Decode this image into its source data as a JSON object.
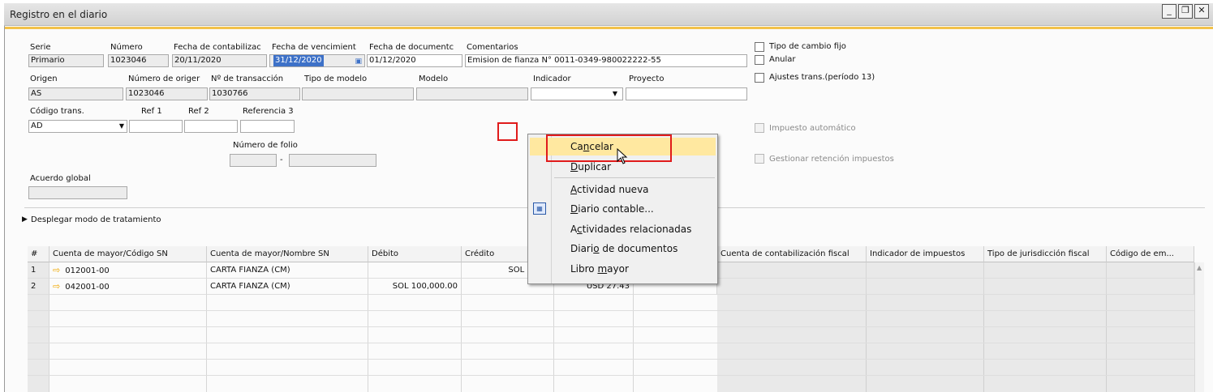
{
  "window": {
    "title": "Registro en el diario"
  },
  "header": {
    "serie": {
      "label": "Serie",
      "value": "Primario"
    },
    "numero": {
      "label": "Número",
      "value": "1023046"
    },
    "fecha_contab": {
      "label": "Fecha de contabilizac",
      "value": "20/11/2020"
    },
    "fecha_venc": {
      "label": "Fecha de vencimient",
      "value": "31/12/2020"
    },
    "fecha_doc": {
      "label": "Fecha de documentc",
      "value": "01/12/2020"
    },
    "comentarios": {
      "label": "Comentarios",
      "value": "Emision de fianza N° 0011-0349-980022222-55"
    },
    "origen": {
      "label": "Origen",
      "value": "AS"
    },
    "numero_origen": {
      "label": "Número de origer",
      "value": "1023046"
    },
    "num_transaccion": {
      "label": "Nº de transacción",
      "value": "1030766"
    },
    "tipo_modelo": {
      "label": "Tipo de modelo",
      "value": ""
    },
    "modelo": {
      "label": "Modelo",
      "value": ""
    },
    "indicador": {
      "label": "Indicador",
      "value": ""
    },
    "proyecto": {
      "label": "Proyecto",
      "value": ""
    },
    "codigo_trans": {
      "label": "Código trans.",
      "value": "AD"
    },
    "ref1": {
      "label": "Ref 1",
      "value": ""
    },
    "ref2": {
      "label": "Ref 2",
      "value": ""
    },
    "referencia3": {
      "label": "Referencia 3",
      "value": ""
    },
    "numero_folio": {
      "label": "Número de folio",
      "separator": "-"
    },
    "acuerdo_global": {
      "label": "Acuerdo global",
      "value": ""
    }
  },
  "checkboxes": {
    "tipo_cambio_fijo": "Tipo de cambio fijo",
    "anular": "Anular",
    "ajustes_trans": "Ajustes trans.(período 13)",
    "impuesto_auto": "Impuesto automático",
    "gestionar_retencion": "Gestionar retención impuestos"
  },
  "expander": {
    "label": "Desplegar modo de tratamiento"
  },
  "table": {
    "columns": [
      "#",
      "Cuenta de mayor/Código SN",
      "Cuenta de mayor/Nombre SN",
      "Débito",
      "Crédito",
      "",
      "",
      "Cuenta de contabilización fiscal",
      "Indicador de impuestos",
      "Tipo de jurisdicción fiscal",
      "Código de em..."
    ],
    "rows": [
      {
        "num": "1",
        "code": "012001-00",
        "name": "CARTA FIANZA (CM)",
        "debit": "",
        "credit": "SOL 100,0",
        "fc": ""
      },
      {
        "num": "2",
        "code": "042001-00",
        "name": "CARTA FIANZA (CM)",
        "debit": "SOL 100,000.00",
        "credit": "",
        "fc": "USD 27.43"
      }
    ]
  },
  "context_menu": {
    "items": [
      {
        "pre": "Ca",
        "key": "n",
        "post": "celar"
      },
      {
        "pre": "",
        "key": "D",
        "post": "uplicar"
      },
      {
        "pre": "",
        "key": "A",
        "post": "ctividad nueva"
      },
      {
        "pre": "",
        "key": "D",
        "post": "iario contable..."
      },
      {
        "pre": "A",
        "key": "c",
        "post": "tividades relacionadas"
      },
      {
        "pre": "Diari",
        "key": "o",
        "post": " de documentos"
      },
      {
        "pre": "Libro ",
        "key": "m",
        "post": "ayor"
      }
    ]
  },
  "colors": {
    "accent": "#f2c24a",
    "highlight": "#ffe8a0",
    "selection": "#3d71c8",
    "annotation": "#e01b1b"
  }
}
